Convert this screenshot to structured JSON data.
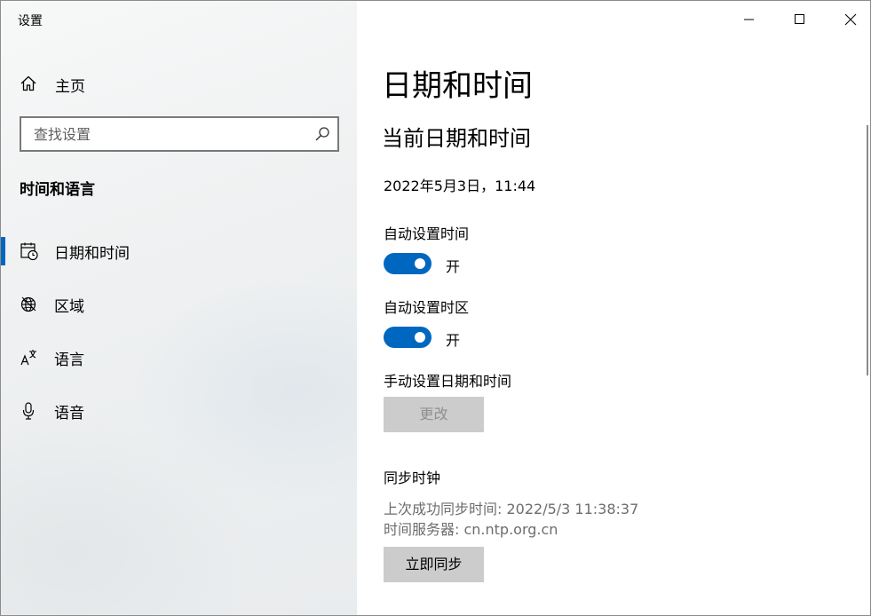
{
  "window": {
    "title": "设置",
    "controls": [
      "minimize",
      "maximize",
      "close"
    ]
  },
  "sidebar": {
    "home_label": "主页",
    "search": {
      "placeholder": "查找设置",
      "value": ""
    },
    "section_title": "时间和语言",
    "items": [
      {
        "label": "日期和时间",
        "icon": "calendar-clock-icon",
        "selected": true
      },
      {
        "label": "区域",
        "icon": "globe-icon",
        "selected": false
      },
      {
        "label": "语言",
        "icon": "language-icon",
        "selected": false
      },
      {
        "label": "语音",
        "icon": "microphone-icon",
        "selected": false
      }
    ]
  },
  "main": {
    "page_title": "日期和时间",
    "subtitle": "当前日期和时间",
    "current_datetime": "2022年5月3日，11:44",
    "auto_time": {
      "label": "自动设置时间",
      "state": "开",
      "on": true
    },
    "auto_timezone": {
      "label": "自动设置时区",
      "state": "开",
      "on": true
    },
    "manual": {
      "label": "手动设置日期和时间",
      "button": "更改"
    },
    "sync": {
      "label": "同步时钟",
      "last_sync": "上次成功同步时间: 2022/5/3 11:38:37",
      "server": "时间服务器: cn.ntp.org.cn",
      "button": "立即同步"
    }
  },
  "colors": {
    "accent": "#0067c0",
    "button_bg": "#cccccc",
    "disabled_text": "#8f8f8f",
    "secondary_text": "#6d6d6d"
  }
}
